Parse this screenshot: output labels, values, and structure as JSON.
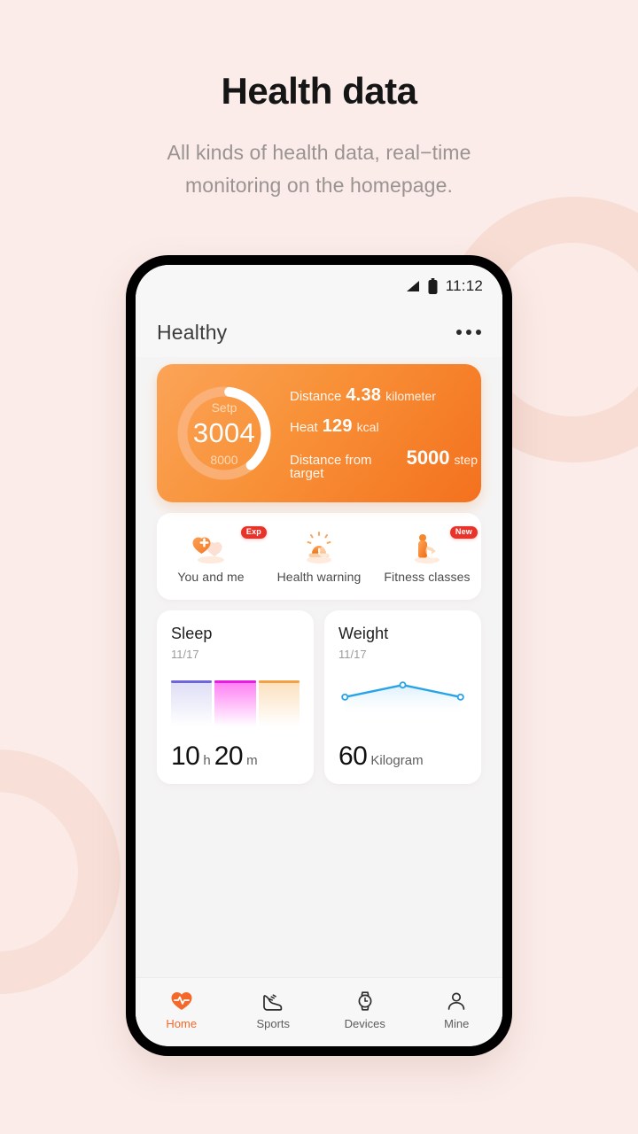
{
  "page": {
    "title": "Health data",
    "subtitle_line1": "All kinds of health data, real−time",
    "subtitle_line2": "monitoring on the homepage.",
    "background_color": "#fbece9"
  },
  "statusbar": {
    "time": "11:12",
    "signal_icon": "signal-triangle-icon",
    "battery_icon": "battery-full-icon"
  },
  "appbar": {
    "title": "Healthy",
    "menu_icon": "more-options-icon"
  },
  "steps_card": {
    "accent_color": "#f4711e",
    "ring": {
      "label": "Setp",
      "value": "3004",
      "goal": "8000",
      "progress_percent": 37
    },
    "stats": [
      {
        "label": "Distance",
        "value": "4.38",
        "unit": "kilometer"
      },
      {
        "label": "Heat",
        "value": "129",
        "unit": "kcal"
      },
      {
        "label": "Distance from target",
        "value": "5000",
        "unit": "step"
      }
    ]
  },
  "shortcuts": [
    {
      "label": "You and me",
      "badge": "Exp",
      "icon": "hearts-plus-icon"
    },
    {
      "label": "Health warning",
      "badge": "",
      "icon": "alarm-warning-icon"
    },
    {
      "label": "Fitness classes",
      "badge": "New",
      "icon": "fitness-play-icon"
    }
  ],
  "metrics": {
    "sleep": {
      "title": "Sleep",
      "date": "11/17",
      "hours": "10",
      "hours_unit": "h",
      "minutes": "20",
      "minutes_unit": "m",
      "bars": [
        {
          "color": "#6f66de"
        },
        {
          "color": "#e61ce0"
        },
        {
          "color": "#f2a144"
        }
      ]
    },
    "weight": {
      "title": "Weight",
      "date": "11/17",
      "value": "60",
      "unit": "Kilogram",
      "line_color": "#29a3e8",
      "points": [
        {
          "x": 0,
          "y": 60
        },
        {
          "x": 1,
          "y": 61
        },
        {
          "x": 2,
          "y": 60
        }
      ]
    }
  },
  "tabbar": {
    "active_color": "#f4682a",
    "items": [
      {
        "label": "Home",
        "icon": "heart-pulse-icon",
        "active": true
      },
      {
        "label": "Sports",
        "icon": "running-shoe-icon",
        "active": false
      },
      {
        "label": "Devices",
        "icon": "watch-icon",
        "active": false
      },
      {
        "label": "Mine",
        "icon": "person-icon",
        "active": false
      }
    ]
  }
}
